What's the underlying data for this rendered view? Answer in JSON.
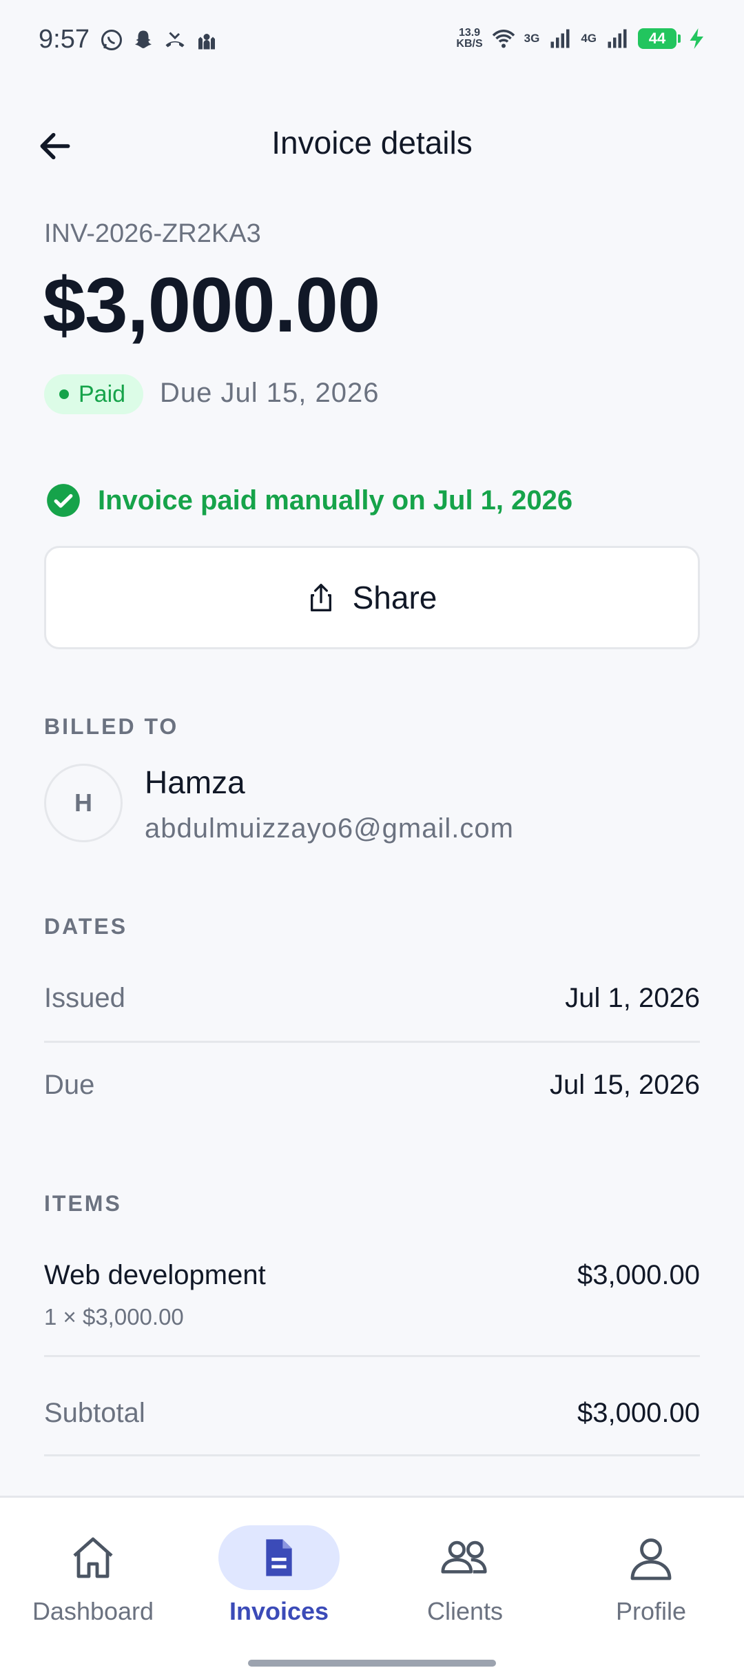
{
  "status_bar": {
    "time": "9:57",
    "net_speed_value": "13.9",
    "net_speed_unit": "KB/S",
    "sim1_label": "3G",
    "sim2_label": "4G",
    "battery": "44"
  },
  "header": {
    "title": "Invoice details"
  },
  "invoice": {
    "number": "INV-2026-ZR2KA3",
    "amount": "$3,000.00",
    "status": "Paid",
    "due_text": "Due Jul 15, 2026",
    "paid_note": "Invoice paid manually on Jul 1, 2026",
    "share_label": "Share"
  },
  "billed_to": {
    "section_label": "BILLED TO",
    "initial": "H",
    "name": "Hamza",
    "email": "abdulmuizzayo6@gmail.com"
  },
  "dates": {
    "section_label": "DATES",
    "issued_label": "Issued",
    "issued_value": "Jul 1, 2026",
    "due_label": "Due",
    "due_value": "Jul 15, 2026"
  },
  "items": {
    "section_label": "ITEMS",
    "list": [
      {
        "name": "Web development",
        "detail": "1 × $3,000.00",
        "total": "$3,000.00"
      }
    ],
    "subtotal_label": "Subtotal",
    "subtotal_value": "$3,000.00"
  },
  "nav": {
    "items": [
      {
        "label": "Dashboard",
        "icon": "home-icon",
        "active": false
      },
      {
        "label": "Invoices",
        "icon": "document-icon",
        "active": true
      },
      {
        "label": "Clients",
        "icon": "users-icon",
        "active": false
      },
      {
        "label": "Profile",
        "icon": "user-icon",
        "active": false
      }
    ]
  },
  "colors": {
    "paid_green": "#16a34a",
    "accent": "#3b4bb8",
    "active_pill": "#e0e7ff"
  }
}
